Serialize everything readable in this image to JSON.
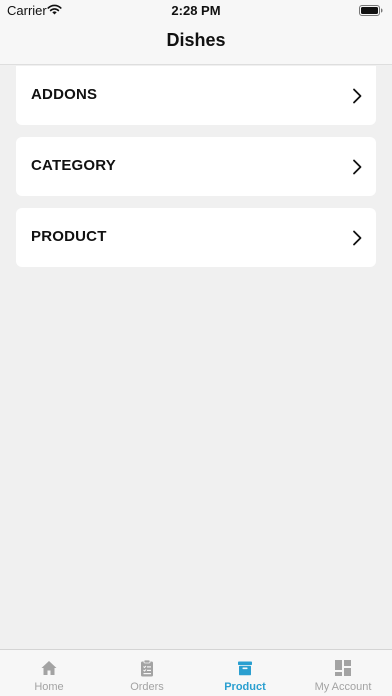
{
  "status_bar": {
    "carrier": "Carrier",
    "time": "2:28 PM",
    "wifi_icon": "wifi-icon",
    "battery_icon": "battery-full-icon"
  },
  "nav": {
    "title": "Dishes"
  },
  "list": {
    "items": [
      {
        "label": "ADDONS",
        "icon": "chevron-right-icon"
      },
      {
        "label": "CATEGORY",
        "icon": "chevron-right-icon"
      },
      {
        "label": "PRODUCT",
        "icon": "chevron-right-icon"
      }
    ]
  },
  "tab_bar": {
    "tabs": [
      {
        "label": "Home",
        "icon": "home-icon",
        "active": false
      },
      {
        "label": "Orders",
        "icon": "clipboard-icon",
        "active": false
      },
      {
        "label": "Product",
        "icon": "archive-box-icon",
        "active": true
      },
      {
        "label": "My Account",
        "icon": "dashboard-icon",
        "active": false
      }
    ]
  },
  "colors": {
    "background": "#f0f0f0",
    "card": "#ffffff",
    "bar": "#f7f7f7",
    "active_tab": "#2a9fd0",
    "inactive_tab": "#a3a3a3"
  }
}
